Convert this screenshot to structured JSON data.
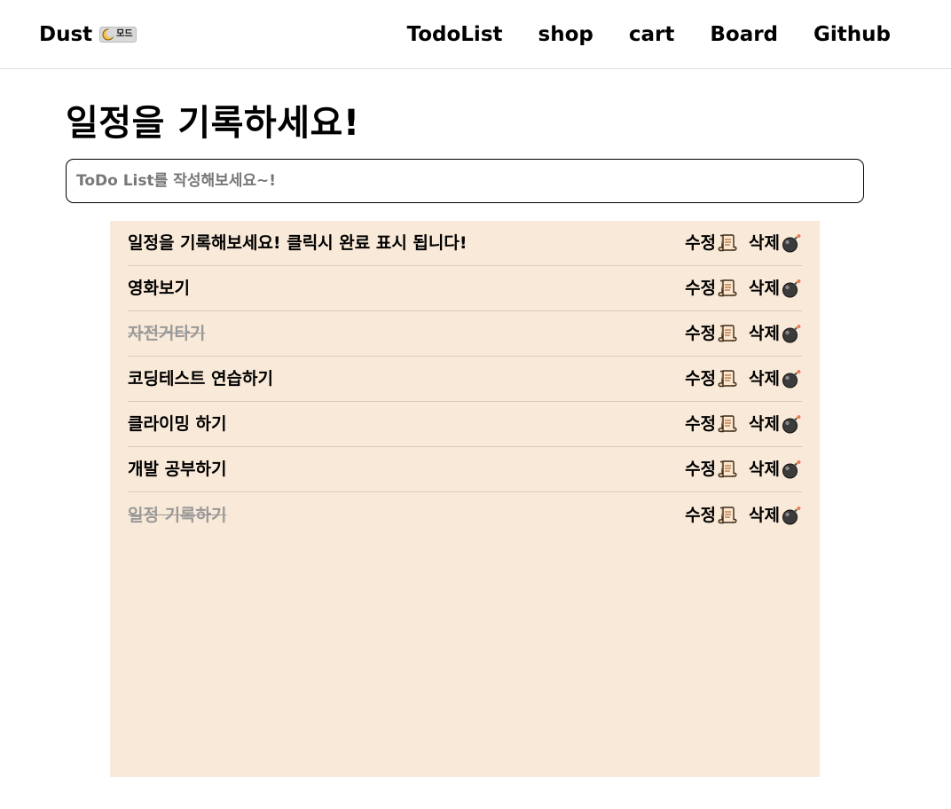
{
  "header": {
    "brand": "Dust",
    "mode_label": "모드",
    "nav": [
      "TodoList",
      "shop",
      "cart",
      "Board",
      "Github"
    ]
  },
  "main": {
    "title": "일정을 기록하세요!",
    "input_placeholder": "ToDo List를 작성해보세요~!",
    "edit_label": "수정",
    "delete_label": "삭제",
    "edit_icon": "scroll-icon",
    "delete_icon": "bomb-icon",
    "todos": [
      {
        "text": "일정을 기록해보세요! 클릭시 완료 표시 됩니다!",
        "done": false
      },
      {
        "text": "영화보기",
        "done": false
      },
      {
        "text": "자전거타기",
        "done": true
      },
      {
        "text": "코딩테스트 연습하기",
        "done": false
      },
      {
        "text": "클라이밍 하기",
        "done": false
      },
      {
        "text": "개발 공부하기",
        "done": false
      },
      {
        "text": "일정 기록하기",
        "done": true
      }
    ]
  },
  "colors": {
    "panel_bg": "#f9e9d8",
    "done_text": "#999999",
    "divider": "#d8cabc"
  }
}
